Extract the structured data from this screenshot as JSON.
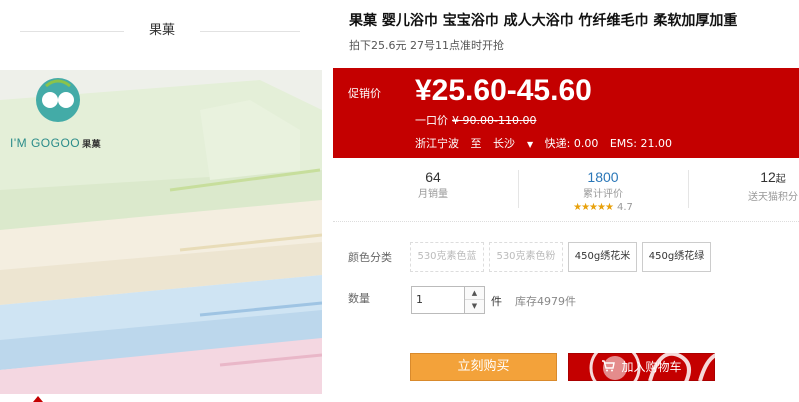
{
  "shop": {
    "name": "果菓"
  },
  "product": {
    "title": "果菓 婴儿浴巾 宝宝浴巾 成人大浴巾 竹纤维毛巾 柔软加厚加重",
    "subtitle": "拍下25.6元 27号11点准时开抢",
    "brand_logo_text": "I'M GOGOO",
    "brand_logo_cn": "果菓"
  },
  "price": {
    "promo_label": "促销价",
    "value": "¥25.60-45.60",
    "original_label": "一口价",
    "original_value": "¥ 90.00-110.00"
  },
  "shipping": {
    "origin": "浙江宁波",
    "to_label": "至",
    "destination": "长沙",
    "express": "快递: 0.00",
    "ems": "EMS: 21.00"
  },
  "stats": {
    "monthly_sales": "64",
    "monthly_sales_label": "月销量",
    "reviews": "1800",
    "reviews_label": "累计评价",
    "rating_stars": "★★★★★",
    "rating": "4.7",
    "points": "12",
    "points_unit": "起",
    "points_label": "送天猫积分"
  },
  "sku": {
    "color_label": "颜色分类",
    "options": [
      {
        "label": "530克素色蓝",
        "disabled": true
      },
      {
        "label": "530克素色粉",
        "disabled": true
      },
      {
        "label": "450g绣花米",
        "disabled": false
      },
      {
        "label": "450g绣花绿",
        "disabled": false
      }
    ],
    "qty_label": "数量",
    "qty_value": "1",
    "qty_unit": "件",
    "stock": "库存4979件"
  },
  "actions": {
    "buy_now": "立刻购买",
    "add_cart": "加入购物车"
  },
  "colors": {
    "brand_red": "#c40000",
    "buy_orange": "#f3a23a"
  }
}
